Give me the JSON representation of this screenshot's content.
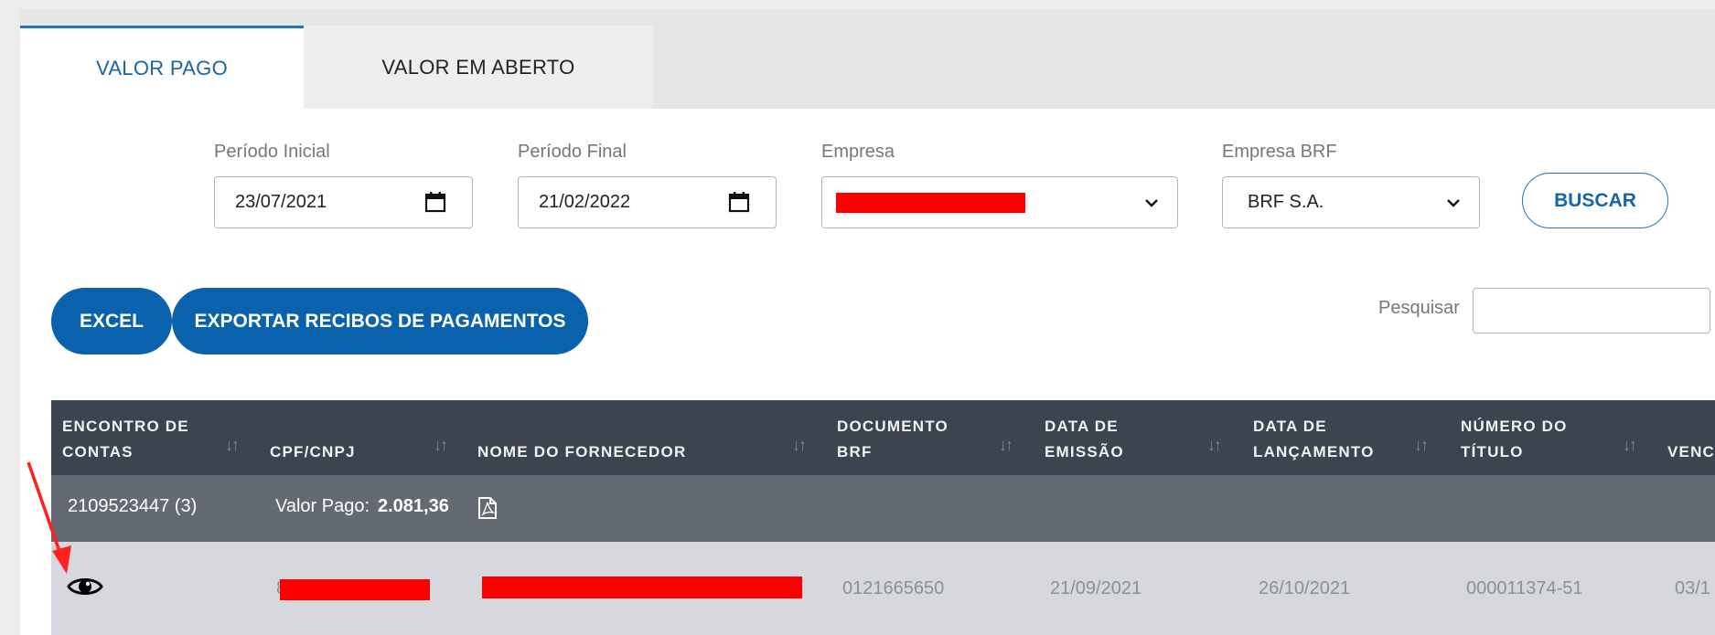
{
  "tabs": {
    "active": "VALOR PAGO",
    "inactive": "VALOR EM ABERTO"
  },
  "filters": {
    "start_label": "Período Inicial",
    "start_value": "23/07/2021",
    "end_label": "Período Final",
    "end_value": "21/02/2022",
    "company_label": "Empresa",
    "brf_company_label": "Empresa BRF",
    "brf_company_value": "BRF S.A.",
    "search_button": "BUSCAR"
  },
  "actions": {
    "excel": "EXCEL",
    "export": "EXPORTAR RECIBOS DE PAGAMENTOS",
    "search_label": "Pesquisar",
    "search_value": ""
  },
  "table": {
    "headers": [
      {
        "line1": "ENCONTRO DE",
        "line2": "CONTAS"
      },
      {
        "line1": "",
        "line2": "CPF/CNPJ"
      },
      {
        "line1": "",
        "line2": "NOME DO FORNECEDOR"
      },
      {
        "line1": "DOCUMENTO",
        "line2": "BRF"
      },
      {
        "line1": "DATA DE",
        "line2": "EMISSÃO"
      },
      {
        "line1": "DATA DE",
        "line2": "LANÇAMENTO"
      },
      {
        "line1": "NÚMERO DO",
        "line2": "TÍTULO"
      },
      {
        "line1": "",
        "line2": "VENC"
      }
    ],
    "sort_glyph": "↓↑",
    "group": {
      "id": "2109523447 (3)",
      "paid_label": "Valor Pago:",
      "paid_value": "2.081,36"
    },
    "row": {
      "cpf_visible": "8",
      "documento": "0121665650",
      "emissao": "21/09/2021",
      "lancamento": "26/10/2021",
      "titulo": "000011374-51",
      "vencimento": "03/1"
    }
  },
  "annotation_color": "#ff2020",
  "icons": [
    "calendar-icon",
    "chevron-down-icon",
    "sort-icon",
    "pdf-icon",
    "eye-icon"
  ]
}
